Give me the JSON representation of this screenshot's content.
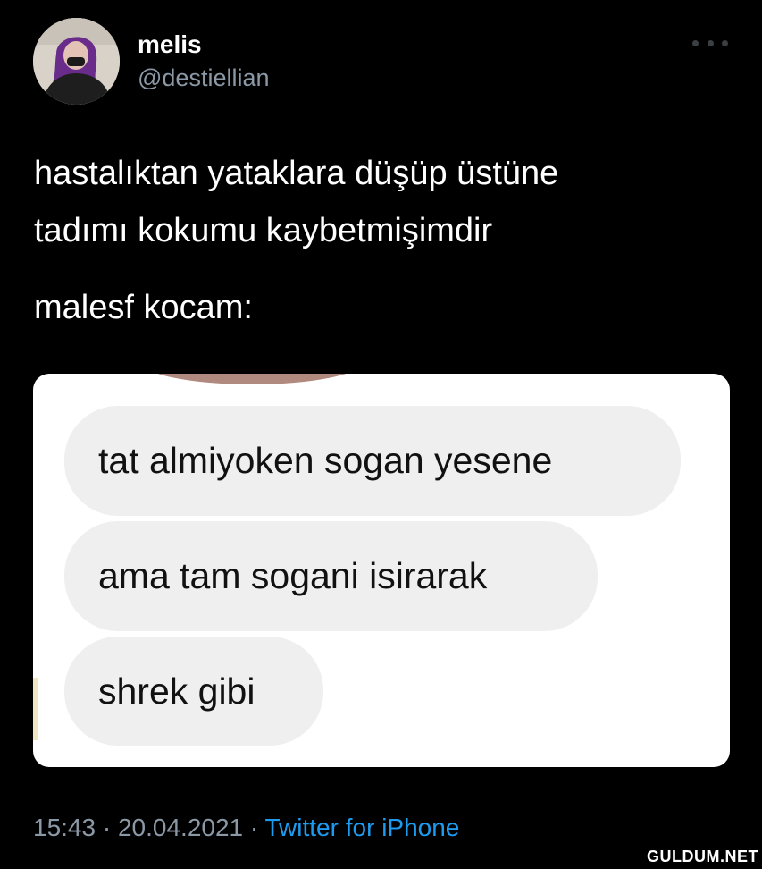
{
  "tweet": {
    "display_name": "melis",
    "handle": "@destiellian",
    "text_line1": "hastalıktan yataklara düşüp üstüne",
    "text_line2": "tadımı kokumu kaybetmişimdir",
    "text_line3": "malesf kocam:",
    "time": "15:43",
    "separator": "·",
    "date": "20.04.2021",
    "source": "Twitter for iPhone"
  },
  "media": {
    "messages": [
      "tat almiyoken sogan yesene",
      "ama tam sogani isirarak",
      "shrek gibi"
    ]
  },
  "watermark": "GULDUM.NET",
  "colors": {
    "background": "#000000",
    "secondary_text": "#8b98a5",
    "link": "#1d9bf0",
    "bubble": "#efefef"
  },
  "icons": {
    "more": "more-horizontal-icon"
  }
}
